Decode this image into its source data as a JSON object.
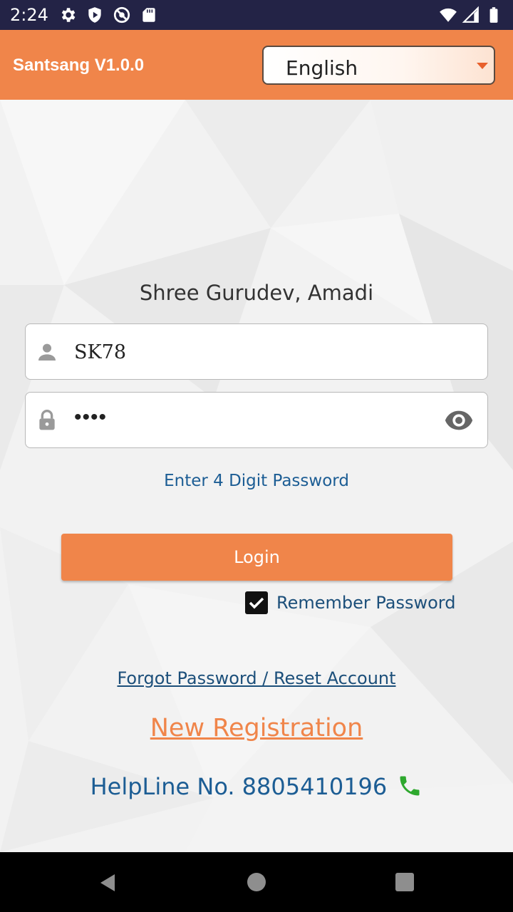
{
  "status_bar": {
    "time": "2:24",
    "left_icons": [
      "settings-icon",
      "shield-icon",
      "no-disturb-icon",
      "sd-card-icon"
    ],
    "right_icons": [
      "wifi-icon",
      "signal-icon",
      "battery-icon"
    ]
  },
  "app_bar": {
    "title": "Santsang V1.0.0",
    "language_selected": "English",
    "accent_color": "#f0854a"
  },
  "login_form": {
    "org_name": "Shree Gurudev, Amadi",
    "username_value": "SK78",
    "password_masked": "••••",
    "password_hint": "Enter 4 Digit Password",
    "login_label": "Login",
    "remember_label": "Remember Password",
    "remember_checked": true,
    "forgot_label": "Forgot Password / Reset Account",
    "register_label": "New Registration",
    "helpline_label": "HelpLine No. 8805410196"
  },
  "nav_bar": {
    "buttons": [
      "back-icon",
      "home-icon",
      "recents-icon"
    ]
  }
}
